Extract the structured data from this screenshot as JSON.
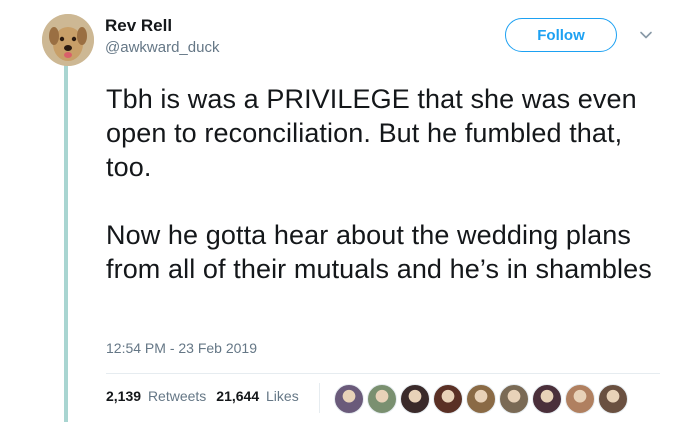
{
  "author": {
    "name": "Rev Rell",
    "handle": "@awkward_duck",
    "avatar_icon": "dog-avatar"
  },
  "follow_label": "Follow",
  "menu_icon": "chevron-down-icon",
  "tweet": {
    "paragraphs": [
      "Tbh is was a PRIVILEGE that she was even open to reconciliation. But he fumbled that, too.",
      "Now he gotta hear about the wedding plans from all of their mutuals and he’s in shambles"
    ]
  },
  "timestamp": "12:54 PM - 23 Feb 2019",
  "stats": {
    "retweets_count": "2,139",
    "retweets_label": "Retweets",
    "likes_count": "21,644",
    "likes_label": "Likes"
  },
  "likers": [
    {
      "color": "#6a5a7a"
    },
    {
      "color": "#7a9070"
    },
    {
      "color": "#3a2a2a"
    },
    {
      "color": "#5a3025"
    },
    {
      "color": "#8a6a45"
    },
    {
      "color": "#7a6a55"
    },
    {
      "color": "#4a2f3a"
    },
    {
      "color": "#b08060"
    },
    {
      "color": "#6a5040"
    }
  ],
  "colors": {
    "accent": "#1da1f2",
    "thread_line": "#a9d5d1",
    "secondary_text": "#657786"
  }
}
